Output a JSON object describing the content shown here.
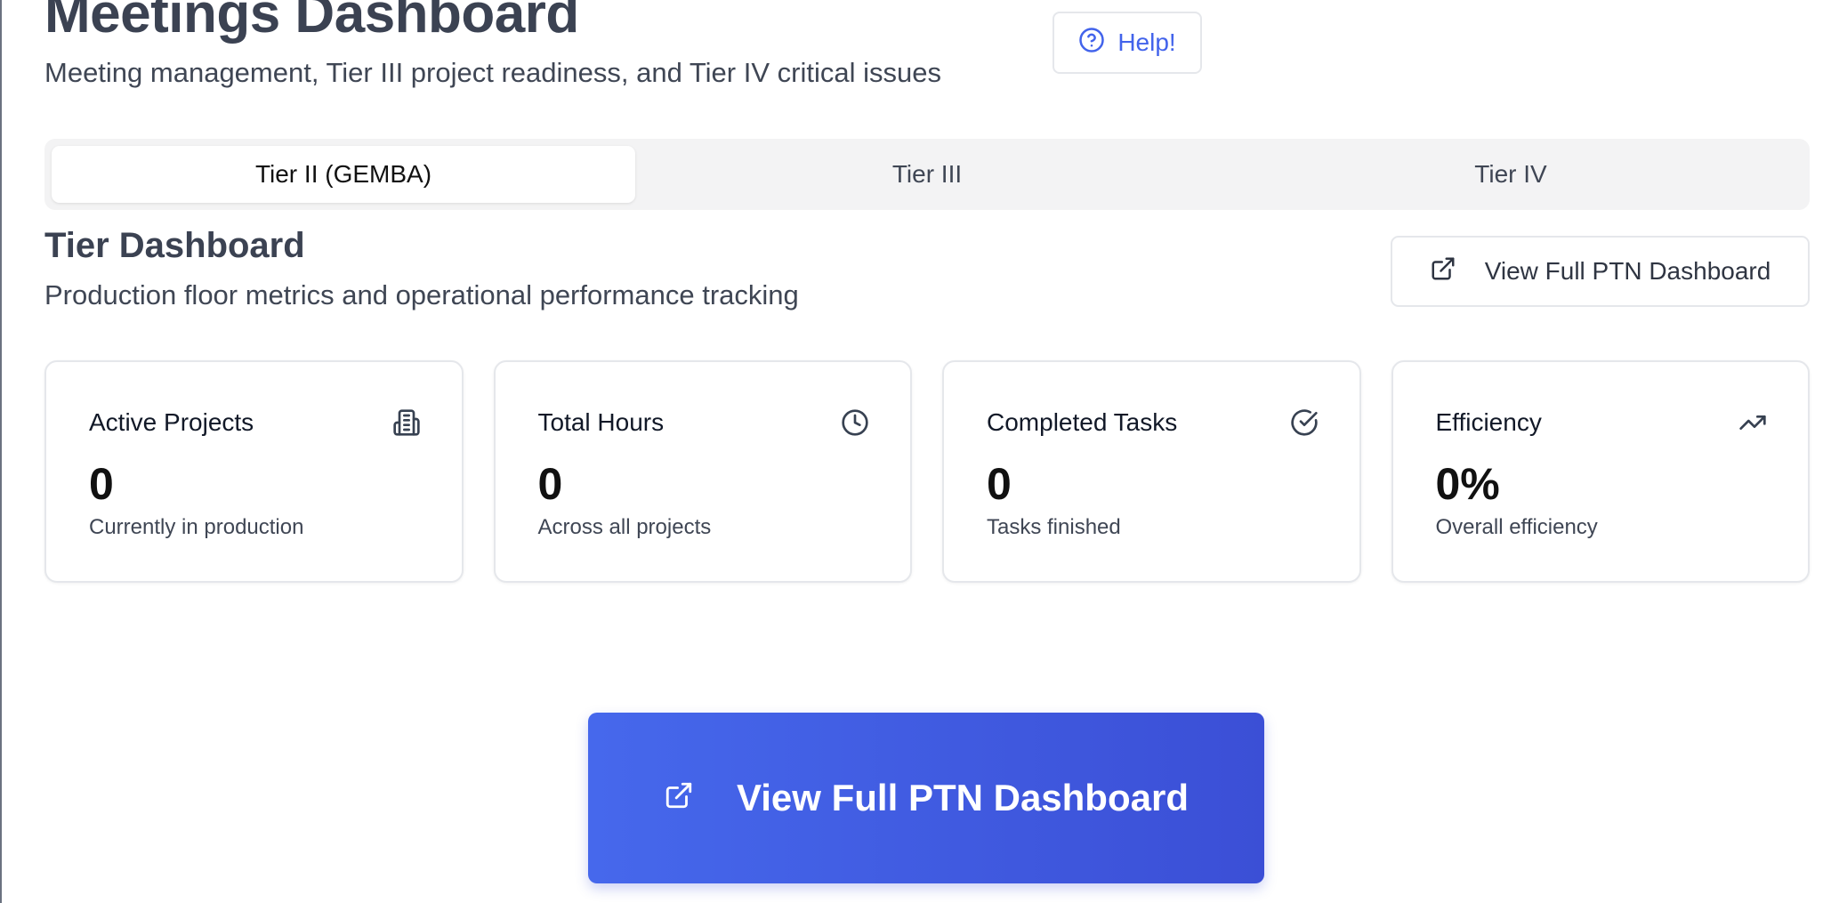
{
  "header": {
    "title": "Meetings Dashboard",
    "subtitle": "Meeting management, Tier III project readiness, and Tier IV critical issues",
    "help_label": "Help!"
  },
  "tabs": [
    {
      "label": "Tier II (GEMBA)",
      "active": true
    },
    {
      "label": "Tier III",
      "active": false
    },
    {
      "label": "Tier IV",
      "active": false
    }
  ],
  "section": {
    "title": "Tier Dashboard",
    "subtitle": "Production floor metrics and operational performance tracking",
    "ptn_button_label": "View Full PTN Dashboard"
  },
  "metrics": [
    {
      "label": "Active Projects",
      "value": "0",
      "description": "Currently in production",
      "icon": "building-icon"
    },
    {
      "label": "Total Hours",
      "value": "0",
      "description": "Across all projects",
      "icon": "clock-icon"
    },
    {
      "label": "Completed Tasks",
      "value": "0",
      "description": "Tasks finished",
      "icon": "check-circle-icon"
    },
    {
      "label": "Efficiency",
      "value": "0%",
      "description": "Overall efficiency",
      "icon": "trending-up-icon"
    }
  ],
  "cta": {
    "label": "View Full PTN Dashboard"
  },
  "colors": {
    "accent": "#4263eb",
    "cta_gradient_start": "#4668ec",
    "cta_gradient_end": "#3b4fd6"
  }
}
